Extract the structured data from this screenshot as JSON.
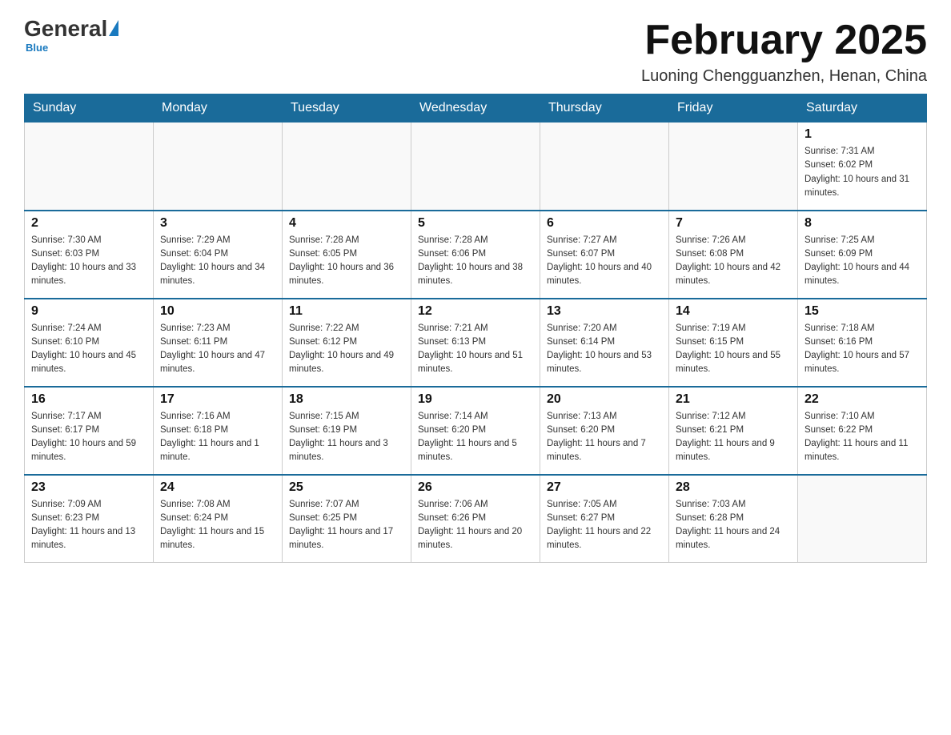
{
  "header": {
    "logo": {
      "general": "General",
      "blue": "Blue"
    },
    "title": "February 2025",
    "subtitle": "Luoning Chengguanzhen, Henan, China"
  },
  "days_of_week": [
    "Sunday",
    "Monday",
    "Tuesday",
    "Wednesday",
    "Thursday",
    "Friday",
    "Saturday"
  ],
  "weeks": [
    [
      {
        "day": "",
        "info": ""
      },
      {
        "day": "",
        "info": ""
      },
      {
        "day": "",
        "info": ""
      },
      {
        "day": "",
        "info": ""
      },
      {
        "day": "",
        "info": ""
      },
      {
        "day": "",
        "info": ""
      },
      {
        "day": "1",
        "info": "Sunrise: 7:31 AM\nSunset: 6:02 PM\nDaylight: 10 hours and 31 minutes."
      }
    ],
    [
      {
        "day": "2",
        "info": "Sunrise: 7:30 AM\nSunset: 6:03 PM\nDaylight: 10 hours and 33 minutes."
      },
      {
        "day": "3",
        "info": "Sunrise: 7:29 AM\nSunset: 6:04 PM\nDaylight: 10 hours and 34 minutes."
      },
      {
        "day": "4",
        "info": "Sunrise: 7:28 AM\nSunset: 6:05 PM\nDaylight: 10 hours and 36 minutes."
      },
      {
        "day": "5",
        "info": "Sunrise: 7:28 AM\nSunset: 6:06 PM\nDaylight: 10 hours and 38 minutes."
      },
      {
        "day": "6",
        "info": "Sunrise: 7:27 AM\nSunset: 6:07 PM\nDaylight: 10 hours and 40 minutes."
      },
      {
        "day": "7",
        "info": "Sunrise: 7:26 AM\nSunset: 6:08 PM\nDaylight: 10 hours and 42 minutes."
      },
      {
        "day": "8",
        "info": "Sunrise: 7:25 AM\nSunset: 6:09 PM\nDaylight: 10 hours and 44 minutes."
      }
    ],
    [
      {
        "day": "9",
        "info": "Sunrise: 7:24 AM\nSunset: 6:10 PM\nDaylight: 10 hours and 45 minutes."
      },
      {
        "day": "10",
        "info": "Sunrise: 7:23 AM\nSunset: 6:11 PM\nDaylight: 10 hours and 47 minutes."
      },
      {
        "day": "11",
        "info": "Sunrise: 7:22 AM\nSunset: 6:12 PM\nDaylight: 10 hours and 49 minutes."
      },
      {
        "day": "12",
        "info": "Sunrise: 7:21 AM\nSunset: 6:13 PM\nDaylight: 10 hours and 51 minutes."
      },
      {
        "day": "13",
        "info": "Sunrise: 7:20 AM\nSunset: 6:14 PM\nDaylight: 10 hours and 53 minutes."
      },
      {
        "day": "14",
        "info": "Sunrise: 7:19 AM\nSunset: 6:15 PM\nDaylight: 10 hours and 55 minutes."
      },
      {
        "day": "15",
        "info": "Sunrise: 7:18 AM\nSunset: 6:16 PM\nDaylight: 10 hours and 57 minutes."
      }
    ],
    [
      {
        "day": "16",
        "info": "Sunrise: 7:17 AM\nSunset: 6:17 PM\nDaylight: 10 hours and 59 minutes."
      },
      {
        "day": "17",
        "info": "Sunrise: 7:16 AM\nSunset: 6:18 PM\nDaylight: 11 hours and 1 minute."
      },
      {
        "day": "18",
        "info": "Sunrise: 7:15 AM\nSunset: 6:19 PM\nDaylight: 11 hours and 3 minutes."
      },
      {
        "day": "19",
        "info": "Sunrise: 7:14 AM\nSunset: 6:20 PM\nDaylight: 11 hours and 5 minutes."
      },
      {
        "day": "20",
        "info": "Sunrise: 7:13 AM\nSunset: 6:20 PM\nDaylight: 11 hours and 7 minutes."
      },
      {
        "day": "21",
        "info": "Sunrise: 7:12 AM\nSunset: 6:21 PM\nDaylight: 11 hours and 9 minutes."
      },
      {
        "day": "22",
        "info": "Sunrise: 7:10 AM\nSunset: 6:22 PM\nDaylight: 11 hours and 11 minutes."
      }
    ],
    [
      {
        "day": "23",
        "info": "Sunrise: 7:09 AM\nSunset: 6:23 PM\nDaylight: 11 hours and 13 minutes."
      },
      {
        "day": "24",
        "info": "Sunrise: 7:08 AM\nSunset: 6:24 PM\nDaylight: 11 hours and 15 minutes."
      },
      {
        "day": "25",
        "info": "Sunrise: 7:07 AM\nSunset: 6:25 PM\nDaylight: 11 hours and 17 minutes."
      },
      {
        "day": "26",
        "info": "Sunrise: 7:06 AM\nSunset: 6:26 PM\nDaylight: 11 hours and 20 minutes."
      },
      {
        "day": "27",
        "info": "Sunrise: 7:05 AM\nSunset: 6:27 PM\nDaylight: 11 hours and 22 minutes."
      },
      {
        "day": "28",
        "info": "Sunrise: 7:03 AM\nSunset: 6:28 PM\nDaylight: 11 hours and 24 minutes."
      },
      {
        "day": "",
        "info": ""
      }
    ]
  ]
}
